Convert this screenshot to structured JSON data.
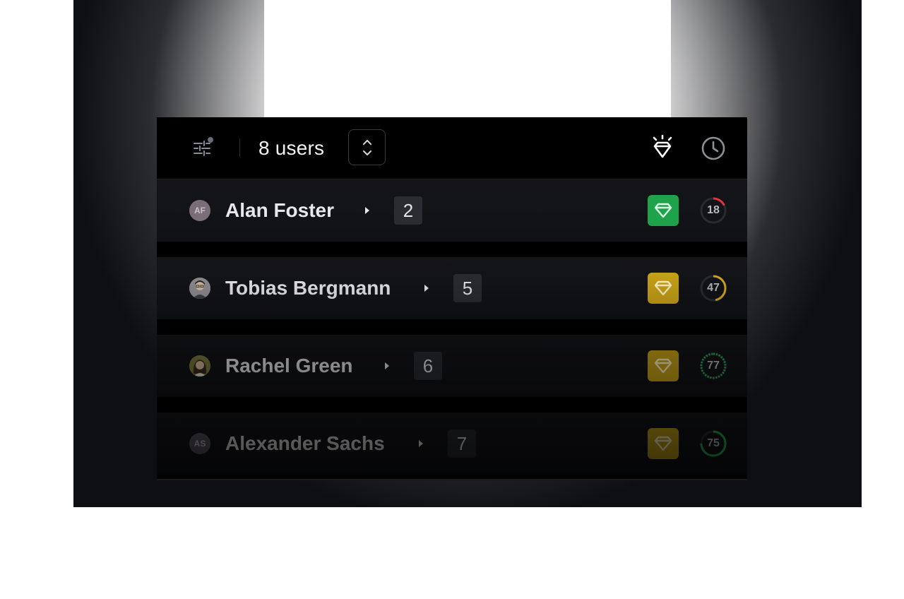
{
  "header": {
    "count_label": "8 users",
    "filter_icon": "sliders-icon",
    "sort_icon": "chevron-up-down-icon",
    "tier_icon": "diamond-sparkle-icon",
    "history_icon": "clock-icon"
  },
  "colors": {
    "tier_green": "#1fa34a",
    "tier_gold": "#c9a418",
    "ring_red": "#e0343f",
    "ring_gold": "#d4a81c",
    "ring_green": "#2bb35b"
  },
  "users": [
    {
      "name": "Alan Foster",
      "initials": "AF",
      "count": "2",
      "tier": "green",
      "score": "18",
      "score_pct": 0.18
    },
    {
      "name": "Tobias Bergmann",
      "initials": "",
      "count": "5",
      "tier": "gold",
      "score": "47",
      "score_pct": 0.47
    },
    {
      "name": "Rachel Green",
      "initials": "",
      "count": "6",
      "tier": "gold",
      "score": "77",
      "score_pct": 0.77
    },
    {
      "name": "Alexander Sachs",
      "initials": "AS",
      "count": "7",
      "tier": "gold",
      "score": "75",
      "score_pct": 0.75
    }
  ]
}
